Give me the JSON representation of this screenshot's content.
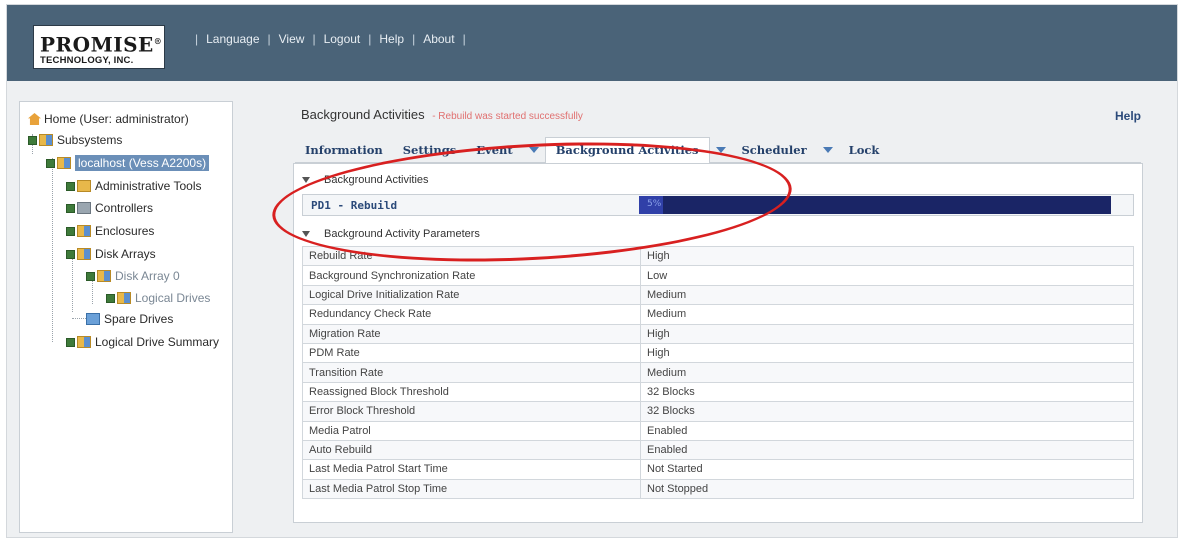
{
  "header": {
    "logo_main": "PROMISE",
    "logo_sub": "TECHNOLOGY, INC.",
    "nav": [
      "Language",
      "View",
      "Logout",
      "Help",
      "About"
    ]
  },
  "sidebar": {
    "items": [
      {
        "label": "Home (User: administrator)"
      },
      {
        "label": "Subsystems"
      },
      {
        "label": "localhost (Vess A2200s)"
      },
      {
        "label": "Administrative Tools"
      },
      {
        "label": "Controllers"
      },
      {
        "label": "Enclosures"
      },
      {
        "label": "Disk Arrays"
      },
      {
        "label": "Disk Array 0"
      },
      {
        "label": "Logical Drives"
      },
      {
        "label": "Spare Drives"
      },
      {
        "label": "Logical Drive Summary"
      }
    ]
  },
  "main": {
    "title": "Background Activities",
    "status_message": "- Rebuild was started successfully",
    "help_label": "Help",
    "tabs": [
      {
        "label": "Information"
      },
      {
        "label": "Settings"
      },
      {
        "label": "Event"
      },
      {
        "label": "Background Activities"
      },
      {
        "label": "Scheduler"
      },
      {
        "label": "Lock"
      }
    ],
    "activities_section": "Background Activities",
    "activity": {
      "name": "PD1 - Rebuild",
      "progress_percent": 5,
      "progress_text": "5%"
    },
    "params_section": "Background Activity Parameters",
    "params": [
      {
        "key": "Rebuild Rate",
        "value": "High"
      },
      {
        "key": "Background Synchronization Rate",
        "value": "Low"
      },
      {
        "key": "Logical Drive Initialization Rate",
        "value": "Medium"
      },
      {
        "key": "Redundancy Check Rate",
        "value": "Medium"
      },
      {
        "key": "Migration Rate",
        "value": "High"
      },
      {
        "key": "PDM Rate",
        "value": "High"
      },
      {
        "key": "Transition Rate",
        "value": "Medium"
      },
      {
        "key": "Reassigned Block Threshold",
        "value": "32 Blocks"
      },
      {
        "key": "Error Block Threshold",
        "value": "32 Blocks"
      },
      {
        "key": "Media Patrol",
        "value": "Enabled"
      },
      {
        "key": "Auto Rebuild",
        "value": "Enabled"
      },
      {
        "key": "Last Media Patrol Start Time",
        "value": "Not Started"
      },
      {
        "key": "Last Media Patrol Stop Time",
        "value": "Not Stopped"
      }
    ]
  },
  "colors": {
    "header_bg": "#4a6378",
    "progress_track": "#1a2566",
    "annotation_ring": "#d82020"
  }
}
